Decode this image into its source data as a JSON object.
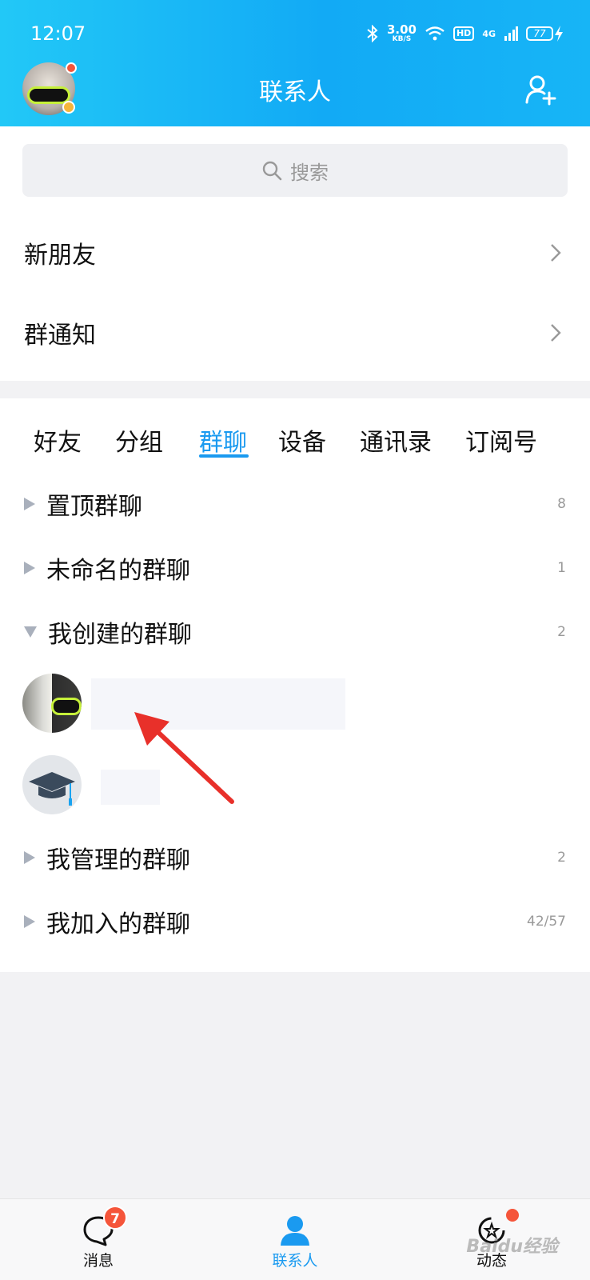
{
  "status_bar": {
    "time": "12:07",
    "net_speed_value": "3.00",
    "net_speed_unit": "KB/S",
    "hd": "HD",
    "network": "4G",
    "battery": "77"
  },
  "header": {
    "title": "联系人"
  },
  "search": {
    "placeholder": "搜索"
  },
  "links": {
    "new_friends": "新朋友",
    "group_notice": "群通知"
  },
  "tabs": [
    "好友",
    "分组",
    "群聊",
    "设备",
    "通讯录",
    "订阅号"
  ],
  "active_tab": "群聊",
  "categories": [
    {
      "label": "置顶群聊",
      "count": "8",
      "expanded": false
    },
    {
      "label": "未命名的群聊",
      "count": "1",
      "expanded": false
    },
    {
      "label": "我创建的群聊",
      "count": "2",
      "expanded": true
    },
    {
      "label": "我管理的群聊",
      "count": "2",
      "expanded": false
    },
    {
      "label": "我加入的群聊",
      "count": "42/57",
      "expanded": false
    }
  ],
  "bottom_nav": {
    "messages": "消息",
    "messages_badge": "7",
    "contacts": "联系人",
    "feed": "动态"
  },
  "watermark": "Baidu经验",
  "colors": {
    "accent": "#1a9af0",
    "header_start": "#22c8f7",
    "header_end": "#12aaf5",
    "badge": "#f5553a",
    "annotation_arrow": "#e8302a"
  }
}
